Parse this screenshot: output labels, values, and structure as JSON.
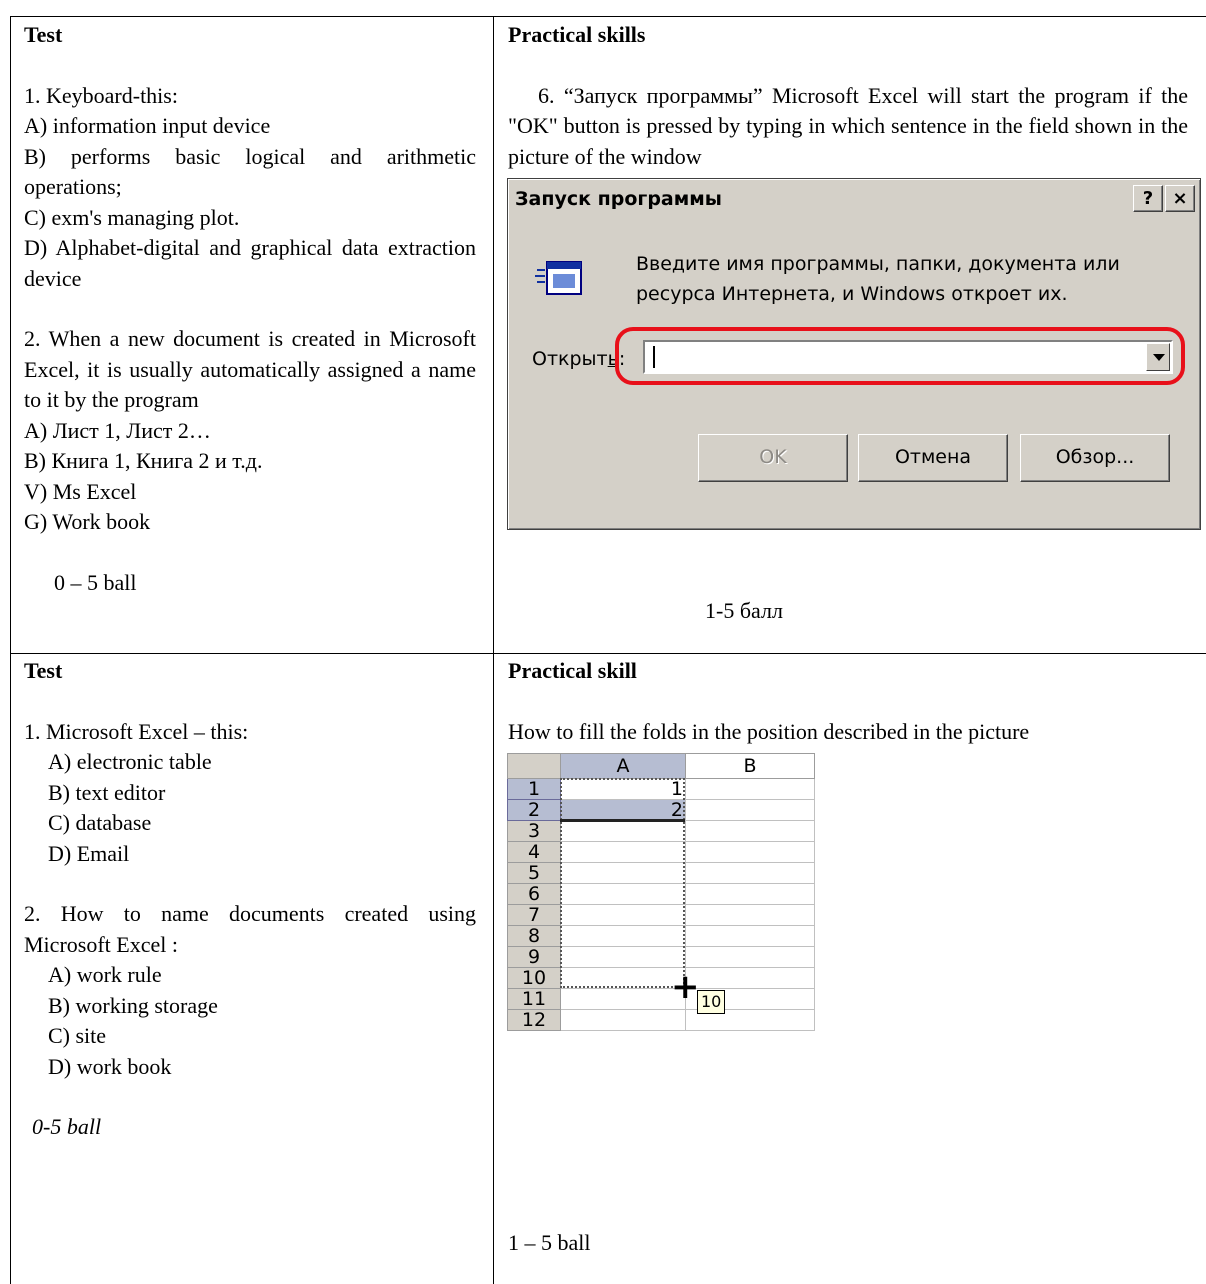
{
  "block1": {
    "left": {
      "heading": "Test",
      "q1": {
        "text": "1. Keyboard-this:",
        "options": [
          "A) information input device",
          "B) performs basic logical and arithmetic operations;",
          "C) exm's managing plot.",
          "D) Alphabet-digital and graphical data extraction device"
        ]
      },
      "q2": {
        "text": "2. When a new document is created in Microsoft Excel, it is usually automatically assigned a name to it by the program",
        "options": [
          "A)  Лист 1, Лист 2…",
          "B)  Книга 1, Книга 2 и т.д.",
          "V)   Ms Excel",
          "G)   Work book"
        ]
      },
      "score": "0 – 5 ball"
    },
    "right": {
      "heading": "Practical skills",
      "task": "6. “Запуск программы” Microsoft Excel will start the program if the \"OK\" button is pressed by typing in which sentence in the field shown in the picture of the window",
      "dialog": {
        "title": "Запуск программы",
        "help_button": "?",
        "close_button": "×",
        "message_line1": "Введите имя программы, папки, документа или",
        "message_line2": "ресурса Интернета, и Windows откроет их.",
        "open_label_prefix": "Открыт",
        "open_label_underlined": "ь",
        "open_label_suffix": ":",
        "field_value": "",
        "ok": "OK",
        "cancel": "Отмена",
        "browse": "Обзор..."
      },
      "score": "1-5 балл"
    }
  },
  "block2": {
    "left": {
      "heading": "Test",
      "q1": {
        "text": "1. Microsoft Excel – this:",
        "options": [
          "A) electronic table",
          "B) text editor",
          "C) database",
          "D) Email"
        ]
      },
      "q2": {
        "text": "2. How to name documents created using Microsoft Excel :",
        "options": [
          "A) work rule",
          "B) working storage",
          "C) site",
          "D) work book"
        ]
      },
      "score": "0-5 ball"
    },
    "right": {
      "heading": "Practical skill",
      "task": "How to fill the folds in the position described in the picture",
      "sheet": {
        "columns": [
          "A",
          "B"
        ],
        "rows": [
          "1",
          "2",
          "3",
          "4",
          "5",
          "6",
          "7",
          "8",
          "9",
          "10",
          "11",
          "12"
        ],
        "values": {
          "A1": "1",
          "A2": "2"
        },
        "fill_tooltip": "10"
      },
      "score": "1 – 5 ball"
    }
  }
}
